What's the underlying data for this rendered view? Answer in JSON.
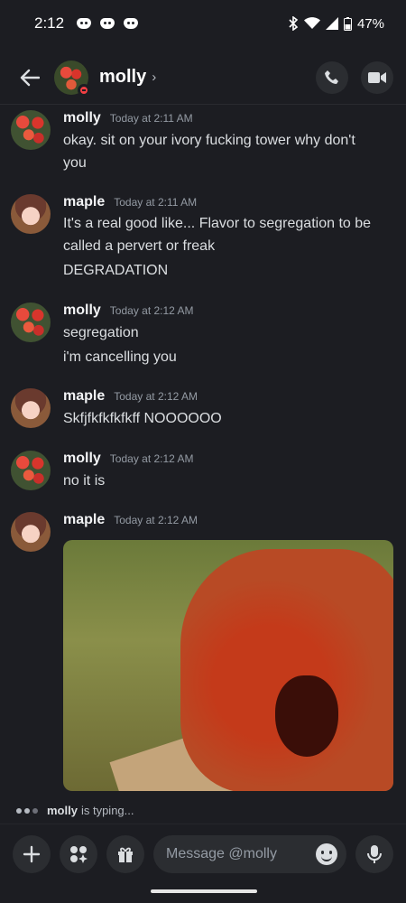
{
  "status": {
    "time": "2:12",
    "battery": "47%",
    "app_icons": [
      "discord-icon",
      "discord-icon",
      "discord-icon"
    ]
  },
  "header": {
    "title": "molly",
    "chevron": "›"
  },
  "messages": [
    {
      "author": "molly",
      "time": "Today at 2:11 AM",
      "lines": [
        "okay. sit on your ivory fucking tower why don't",
        "you"
      ]
    },
    {
      "author": "maple",
      "time": "Today at 2:11 AM",
      "lines": [
        "It's a real good like... Flavor to segregation to be",
        "called a pervert or freak",
        "DEGRADATION"
      ]
    },
    {
      "author": "molly",
      "time": "Today at 2:12 AM",
      "lines": [
        "segregation",
        "i'm cancelling you"
      ]
    },
    {
      "author": "maple",
      "time": "Today at 2:12 AM",
      "lines": [
        "Skfjfkfkfkfkff NOOOOOO"
      ]
    },
    {
      "author": "molly",
      "time": "Today at 2:12 AM",
      "lines": [
        "no it is"
      ]
    },
    {
      "author": "maple",
      "time": "Today at 2:12 AM",
      "lines": []
    }
  ],
  "typing": {
    "name": "molly",
    "text": "is typing..."
  },
  "composer": {
    "placeholder": "Message @molly"
  },
  "colors": {
    "background": "#1c1d22",
    "dnd_status": "#f23f43",
    "button_bg": "#2b2d31"
  }
}
